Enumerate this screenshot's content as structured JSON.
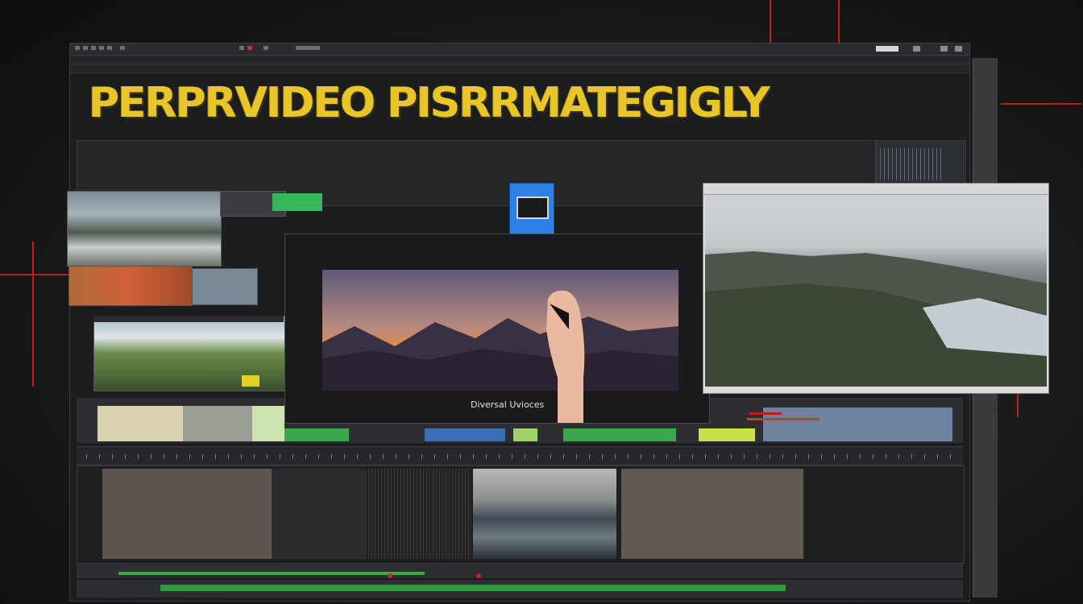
{
  "title": "PERPRVIDEO  PISRRMATEGIGLY",
  "preview": {
    "caption": "Diversal Uvioces"
  },
  "colors": {
    "accent_title": "#e8c62a",
    "window_bg": "#1c1d1f",
    "guide_red": "#c21d1d",
    "clip_green": "#3aa84a",
    "clip_blue": "#3a6db5"
  },
  "icons": {
    "window_controls": [
      "minimize-icon",
      "maximize-icon",
      "close-icon"
    ],
    "media_icon": "film-icon",
    "cursor_icon": "pointer-hand"
  }
}
